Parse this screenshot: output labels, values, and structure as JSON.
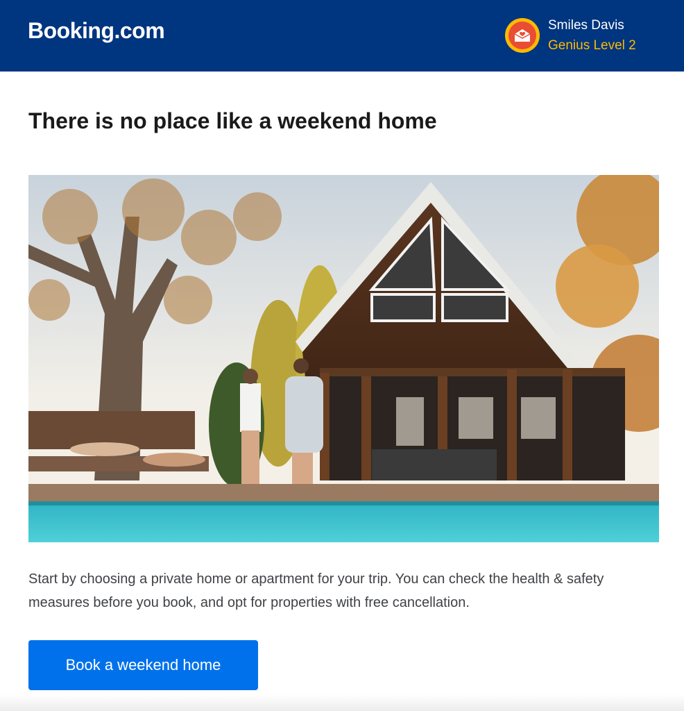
{
  "header": {
    "logo_text": "Booking.com",
    "user_name": "Smiles Davis",
    "user_level": "Genius Level 2",
    "avatar_icon": "genius-envelope-icon",
    "brand_color": "#003580",
    "accent_color": "#febb02"
  },
  "main": {
    "title": "There is no place like a weekend home",
    "hero_image": "weekend-house-pool-photo",
    "body_text": "Start by choosing a private home or apartment for your trip. You can check the health & safety measures before you book, and opt for properties with free cancellation.",
    "cta_label": "Book a weekend home",
    "cta_color": "#0071eb"
  }
}
